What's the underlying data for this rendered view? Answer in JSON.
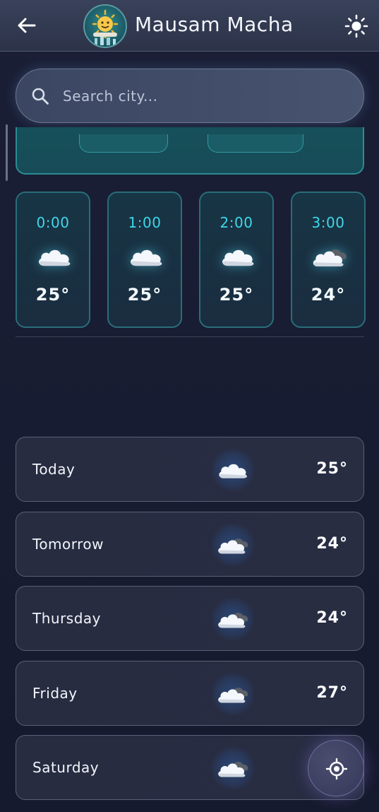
{
  "header": {
    "back_icon": "arrow-left-icon",
    "logo_icon": "smiling-sun-logo",
    "title": "Mausam Macha",
    "theme_icon": "sun-icon"
  },
  "search": {
    "icon": "search-icon",
    "placeholder": "Search city..."
  },
  "hourly": [
    {
      "time": "0:00",
      "icon": "cloud-icon",
      "temp": "25°"
    },
    {
      "time": "1:00",
      "icon": "cloud-icon",
      "temp": "25°"
    },
    {
      "time": "2:00",
      "icon": "cloud-icon",
      "temp": "25°"
    },
    {
      "time": "3:00",
      "icon": "partly-cloudy-icon",
      "temp": "24°"
    }
  ],
  "daily": [
    {
      "day": "Today",
      "icon": "cloud-icon",
      "temp": "25°"
    },
    {
      "day": "Tomorrow",
      "icon": "partly-cloudy-icon",
      "temp": "24°"
    },
    {
      "day": "Thursday",
      "icon": "partly-cloudy-icon",
      "temp": "24°"
    },
    {
      "day": "Friday",
      "icon": "partly-cloudy-icon",
      "temp": "27°"
    },
    {
      "day": "Saturday",
      "icon": "partly-cloudy-icon",
      "temp": ""
    }
  ],
  "fab": {
    "icon": "location-target-icon"
  },
  "colors": {
    "accent_cyan": "#3fd7ea",
    "background": "#171b30",
    "card_border": "#596178"
  }
}
